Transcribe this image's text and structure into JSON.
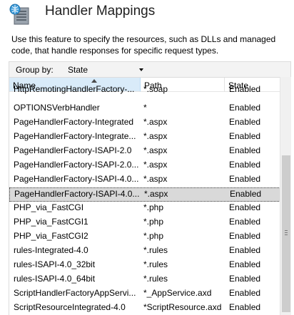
{
  "header": {
    "title": "Handler Mappings",
    "icon": "handler-mappings-icon"
  },
  "description": "Use this feature to specify the resources, such as DLLs and managed code, that handle responses for specific request types.",
  "group_by": {
    "label": "Group by:",
    "value": "State"
  },
  "columns": {
    "name": "Name",
    "path": "Path",
    "state": "State"
  },
  "rows": [
    {
      "name": "HttpRemotingHandlerFactory-...",
      "path": "*.soap",
      "state": "Enabled"
    },
    {
      "name": "OPTIONSVerbHandler",
      "path": "*",
      "state": "Enabled"
    },
    {
      "name": "PageHandlerFactory-Integrated",
      "path": "*.aspx",
      "state": "Enabled"
    },
    {
      "name": "PageHandlerFactory-Integrate...",
      "path": "*.aspx",
      "state": "Enabled"
    },
    {
      "name": "PageHandlerFactory-ISAPI-2.0",
      "path": "*.aspx",
      "state": "Enabled"
    },
    {
      "name": "PageHandlerFactory-ISAPI-2.0...",
      "path": "*.aspx",
      "state": "Enabled"
    },
    {
      "name": "PageHandlerFactory-ISAPI-4.0...",
      "path": "*.aspx",
      "state": "Enabled"
    },
    {
      "name": "PageHandlerFactory-ISAPI-4.0...",
      "path": "*.aspx",
      "state": "Enabled"
    },
    {
      "name": "PHP_via_FastCGI",
      "path": "*.php",
      "state": "Enabled"
    },
    {
      "name": "PHP_via_FastCGI1",
      "path": "*.php",
      "state": "Enabled"
    },
    {
      "name": "PHP_via_FastCGI2",
      "path": "*.php",
      "state": "Enabled"
    },
    {
      "name": "rules-Integrated-4.0",
      "path": "*.rules",
      "state": "Enabled"
    },
    {
      "name": "rules-ISAPI-4.0_32bit",
      "path": "*.rules",
      "state": "Enabled"
    },
    {
      "name": "rules-ISAPI-4.0_64bit",
      "path": "*.rules",
      "state": "Enabled"
    },
    {
      "name": "ScriptHandlerFactoryAppServi...",
      "path": "*_AppService.axd",
      "state": "Enabled"
    },
    {
      "name": "ScriptResourceIntegrated-4.0",
      "path": "*ScriptResource.axd",
      "state": "Enabled"
    }
  ],
  "selected_row_index": 7
}
